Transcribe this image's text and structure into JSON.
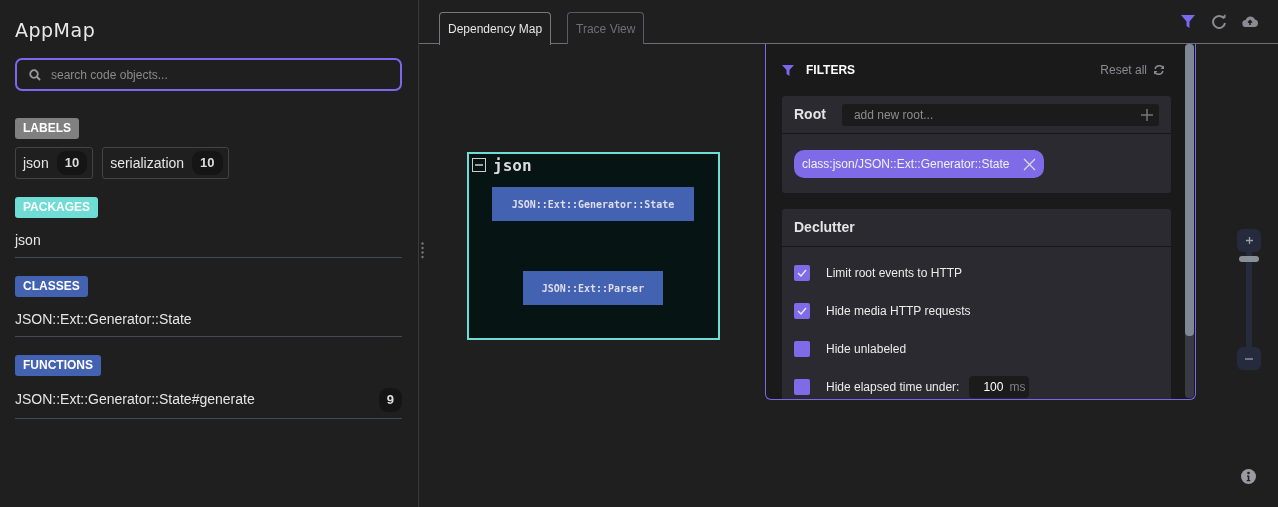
{
  "app": {
    "title": "AppMap",
    "search": {
      "placeholder": "search code objects..."
    }
  },
  "sections": [
    {
      "kind": "chips",
      "heading": "LABELS",
      "color": "#808080",
      "items": [
        {
          "name": "json",
          "count": "10"
        },
        {
          "name": "serialization",
          "count": "10"
        }
      ]
    },
    {
      "kind": "list",
      "heading": "PACKAGES",
      "color": "#6fddd6",
      "items": [
        {
          "name": "json"
        }
      ]
    },
    {
      "kind": "list",
      "heading": "CLASSES",
      "color": "#4362b1",
      "items": [
        {
          "name": "JSON::Ext::Generator::State"
        }
      ]
    },
    {
      "kind": "list",
      "heading": "FUNCTIONS",
      "color": "#4362b1",
      "items": [
        {
          "name": "JSON::Ext::Generator::State#generate",
          "count": "9"
        }
      ]
    }
  ],
  "tabs": [
    {
      "label": "Dependency Map",
      "selected": true
    },
    {
      "label": "Trace View",
      "selected": false
    }
  ],
  "toolbar": [
    {
      "kind": "filter",
      "active": true
    },
    {
      "kind": "reload",
      "active": false
    },
    {
      "kind": "upload",
      "active": false
    }
  ],
  "map": {
    "package": {
      "name": "json",
      "expanded": true,
      "classes": [
        {
          "name": "JSON::Ext::Generator::State"
        },
        {
          "name": "JSON::Ext::Parser"
        }
      ]
    }
  },
  "filters": {
    "title": "FILTERS",
    "reset": "Reset all",
    "root": {
      "heading": "Root",
      "placeholder": "add new root...",
      "tags": [
        "class:json/JSON::Ext::Generator::State"
      ]
    },
    "declutter": {
      "heading": "Declutter",
      "options": [
        {
          "label": "Limit root events to HTTP",
          "checked": true
        },
        {
          "label": "Hide media HTTP requests",
          "checked": true
        },
        {
          "label": "Hide unlabeled",
          "checked": false
        },
        {
          "label": "Hide elapsed time under:",
          "checked": false,
          "value": "100",
          "unit": "ms"
        }
      ]
    }
  },
  "zoom": {
    "level": 0.95
  }
}
